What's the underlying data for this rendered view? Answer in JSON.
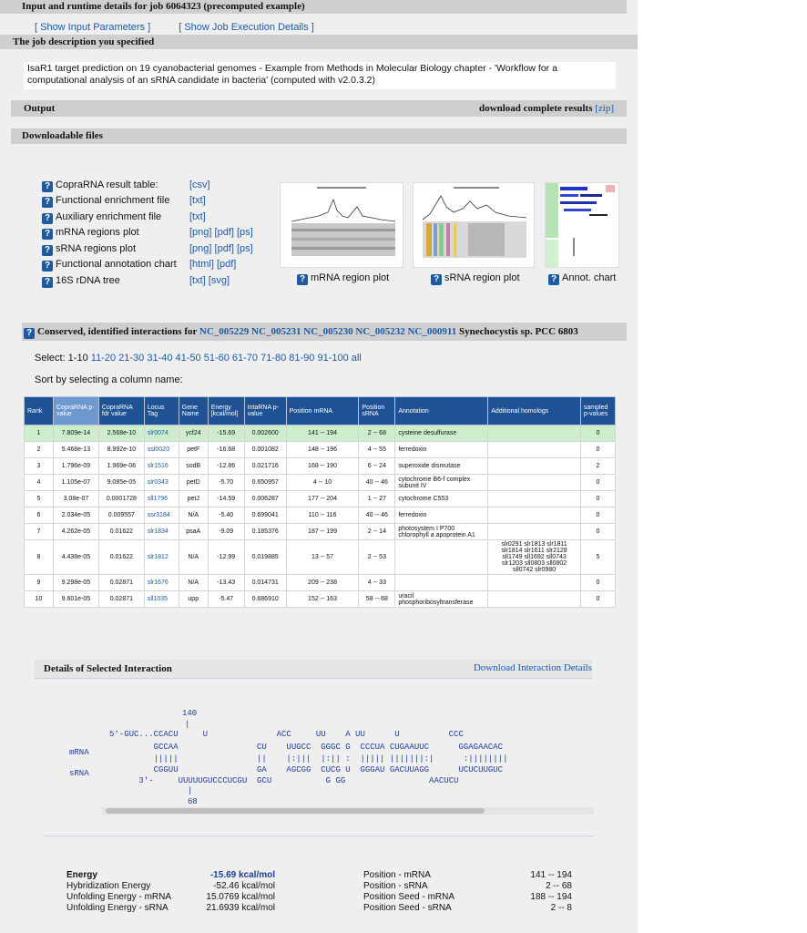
{
  "header": {
    "title": "Input and runtime details for job 6064323 (precomputed example)",
    "show_input": "[ Show Input Parameters ]",
    "show_exec": "[ Show Job Execution Details ]"
  },
  "description": {
    "heading": "The job description you specified",
    "text": "IsaR1 target prediction on 19 cyanobacterial genomes - Example from Methods in Molecular Biology chapter - 'Workflow for a computational analysis of an sRNA candidate in bacteria' (computed with v2.0.3.2)"
  },
  "output": {
    "heading": "Output",
    "download_label": "download complete results",
    "zip": "[zip]"
  },
  "downloadable": {
    "heading": "Downloadable files",
    "items": [
      {
        "label": "CopraRNA result table:",
        "formats": "[csv]"
      },
      {
        "label": "Functional enrichment file",
        "formats": "[txt]"
      },
      {
        "label": "Auxiliary enrichment file",
        "formats": "[txt]"
      },
      {
        "label": "mRNA regions plot",
        "formats": "[png] [pdf] [ps]"
      },
      {
        "label": "sRNA regions plot",
        "formats": "[png] [pdf] [ps]"
      },
      {
        "label": "Functional annotation chart",
        "formats": "[html] [pdf]"
      },
      {
        "label": "16S rDNA tree",
        "formats": "[txt] [svg]"
      }
    ],
    "thumbs": [
      "mRNA region plot",
      "sRNA region plot",
      "Annot. chart"
    ]
  },
  "conserved": {
    "prefix": "Conserved, identified interactions for",
    "ids": "NC_005229 NC_005231 NC_005230 NC_005232 NC_000911",
    "suffix": "Synechocystis sp. PCC 6803",
    "select_label": "Select: 1-10",
    "select_links": "11-20 21-30 31-40 41-50 51-60 61-70 71-80 81-90 91-100 all",
    "sort_label": "Sort by selecting a column name:"
  },
  "table": {
    "headers": [
      "Rank",
      "CopraRNA p-value",
      "CopraRNA fdr value",
      "Locus Tag",
      "Gene Name",
      "Energy [kcal/mol]",
      "IntaRNA p-value",
      "Position mRNA",
      "Position sRNA",
      "Annotation",
      "Additional homologs",
      "sampled p-values"
    ],
    "rows": [
      [
        "1",
        "7.809e-14",
        "2.568e-10",
        "slr0074",
        "ycf24",
        "-15.69",
        "0.002600",
        "141 -- 194",
        "2 -- 68",
        "cysteine desulfurase",
        "",
        "0"
      ],
      [
        "2",
        "5.468e-13",
        "8.992e-10",
        "ssl0020",
        "petF",
        "-16.68",
        "0.001082",
        "148 -- 196",
        "4 -- 55",
        "ferredoxin",
        "",
        "0"
      ],
      [
        "3",
        "1.796e-09",
        "1.969e-06",
        "slr1516",
        "sodB",
        "-12.86",
        "0.021716",
        "168 -- 190",
        "6 -- 24",
        "superoxide dismutase",
        "",
        "2"
      ],
      [
        "4",
        "1.105e-07",
        "9.085e-05",
        "slr0343",
        "petD",
        "-5.70",
        "0.650957",
        "4 -- 10",
        "40 -- 46",
        "cytochrome B6-f complex subunit IV",
        "",
        "0"
      ],
      [
        "5",
        "3.08e-07",
        "0.0001728",
        "sll1796",
        "petJ",
        "-14.59",
        "0.006287",
        "177 -- 204",
        "1 -- 27",
        "cytochrome C553",
        "",
        "0"
      ],
      [
        "6",
        "2.034e-05",
        "0.009557",
        "ssr3184",
        "N/A",
        "-5.40",
        "0.699041",
        "110 -- 116",
        "40 -- 46",
        "ferredoxin",
        "",
        "0"
      ],
      [
        "7",
        "4.262e-05",
        "0.01622",
        "slr1834",
        "psaA",
        "-9.09",
        "0.185376",
        "187 -- 199",
        "2 -- 14",
        "photosystem I P700 chlorophyll a apoprotein A1",
        "",
        "0"
      ],
      [
        "8",
        "4.438e-05",
        "0.01622",
        "slr1812",
        "N/A",
        "-12.99",
        "0.019885",
        "13 -- 57",
        "2 -- 53",
        "",
        "slr0291 slr1813 slr1811 slr1814 slr1611 slr2128 sll1749 sll1692 sll0743 slr1203 sll0803 sll0802 sll0742 slr0980",
        "5"
      ],
      [
        "9",
        "9.298e-05",
        "0.02871",
        "slr1676",
        "N/A",
        "-13.43",
        "0.014731",
        "209 -- 238",
        "4 -- 33",
        "",
        "",
        "0"
      ],
      [
        "10",
        "9.601e-05",
        "0.02871",
        "sll1035",
        "upp",
        "-5.47",
        "0.686910",
        "152 -- 163",
        "58 -- 68",
        "uracil phosphoribosyltransferase",
        "",
        "0"
      ]
    ]
  },
  "details": {
    "heading": "Details of Selected Interaction",
    "download": "Download Interaction Details",
    "pos_top": "140",
    "pos_bottom": "68",
    "mrna_label": "mRNA",
    "srna_label": "sRNA",
    "line1": "5'-GUC...CCACU     U              ACC     UU    A UU      U          CCC",
    "line2": "         GCCAA                CU    UUGCC  GGGC G  CCCUA CUGAAUUC      GGAGAACAC",
    "line3": "         |||||                ||    |:|||  |:|| :  ||||| |||||||:|      :||||||||",
    "line4": "         CGGUU                GA    AGCGG  CUCG U  GGGAU GACUUAGG      UCUCUUGUC",
    "line5": "      3'-     UUUUUGUCCCUCGU  GCU           G GG                 AACUCU"
  },
  "energy": {
    "left": [
      {
        "label": "Energy",
        "value": "-15.69 kcal/mol"
      },
      {
        "label": "Hybridization Energy",
        "value": "-52.46 kcal/mol"
      },
      {
        "label": "Unfolding Energy - mRNA",
        "value": "15.0769 kcal/mol"
      },
      {
        "label": "Unfolding Energy - sRNA",
        "value": "21.6939 kcal/mol"
      }
    ],
    "right": [
      {
        "label": "Position - mRNA",
        "value": "141 -- 194"
      },
      {
        "label": "Position - sRNA",
        "value": "2 -- 68"
      },
      {
        "label": "Position Seed - mRNA",
        "value": "188 -- 194"
      },
      {
        "label": "Position Seed - sRNA",
        "value": "2 -- 8"
      }
    ]
  }
}
